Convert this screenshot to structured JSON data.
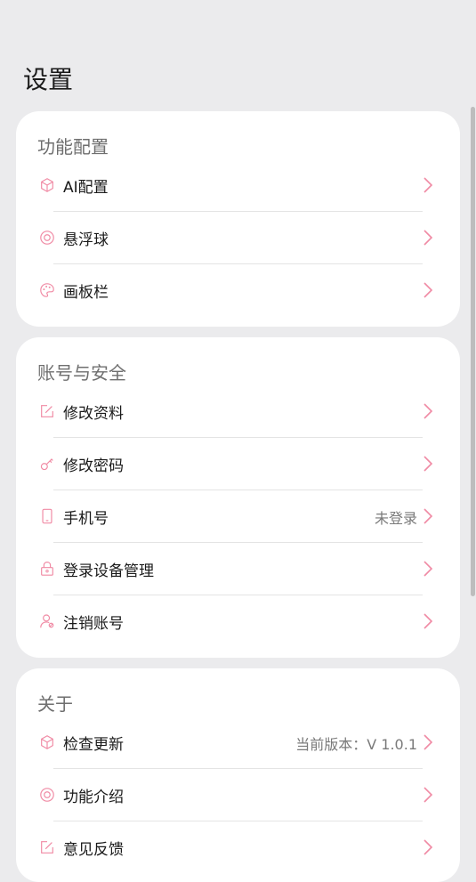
{
  "page": {
    "title": "设置"
  },
  "sections": [
    {
      "title": "功能配置",
      "items": [
        {
          "label": "AI配置",
          "icon": "cube-icon"
        },
        {
          "label": "悬浮球",
          "icon": "target-icon"
        },
        {
          "label": "画板栏",
          "icon": "palette-icon"
        }
      ]
    },
    {
      "title": "账号与安全",
      "items": [
        {
          "label": "修改资料",
          "icon": "edit-icon"
        },
        {
          "label": "修改密码",
          "icon": "key-icon"
        },
        {
          "label": "手机号",
          "icon": "phone-icon",
          "value": "未登录"
        },
        {
          "label": "登录设备管理",
          "icon": "lock-icon"
        },
        {
          "label": "注销账号",
          "icon": "user-icon"
        }
      ]
    },
    {
      "title": "关于",
      "items": [
        {
          "label": "检查更新",
          "icon": "cube-icon",
          "value": "当前版本：V 1.0.1"
        },
        {
          "label": "功能介绍",
          "icon": "target-icon"
        },
        {
          "label": "意见反馈",
          "icon": "edit-icon"
        }
      ]
    }
  ],
  "colors": {
    "accent": "#f08aa4",
    "background": "#ebebed"
  }
}
